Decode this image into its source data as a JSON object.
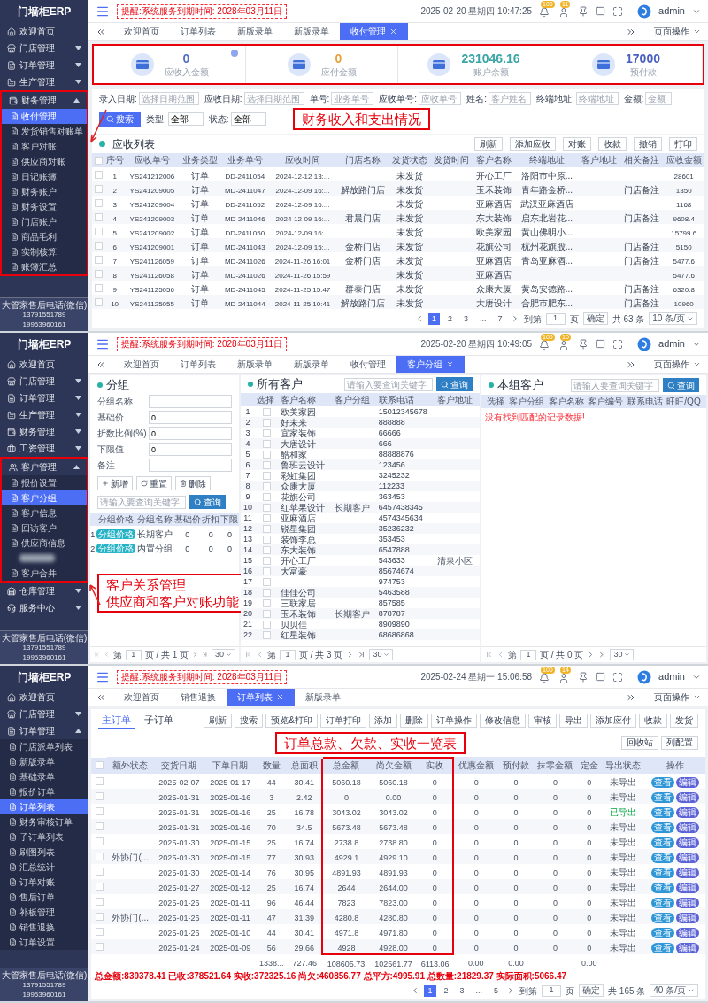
{
  "panels": [
    {
      "kind": "receivables",
      "sidebar": {
        "logo": "门墙柜ERP",
        "items": [
          {
            "label": "欢迎首页"
          },
          {
            "label": "门店管理",
            "expanded": false
          },
          {
            "label": "订单管理",
            "expanded": false
          },
          {
            "label": "生产管理",
            "expanded": false
          },
          {
            "label": "财务管理",
            "expanded": true,
            "highlighted": true,
            "children": [
              {
                "label": "收付管理",
                "selected": true
              },
              {
                "label": "发货销售对账单",
                "selected": false
              },
              {
                "label": "客户对账",
                "selected": false
              },
              {
                "label": "供应商对账",
                "selected": false
              },
              {
                "label": "日记账簿",
                "selected": false
              },
              {
                "label": "财务账户",
                "selected": false
              },
              {
                "label": "财务设置",
                "selected": false
              },
              {
                "label": "门店账户",
                "selected": false
              },
              {
                "label": "商品毛利",
                "selected": false
              },
              {
                "label": "实制核算",
                "selected": false
              },
              {
                "label": "账簿汇总",
                "selected": false
              }
            ]
          }
        ],
        "contact": [
          "大管家售后电话(微信)",
          "13791551789",
          "19953960161"
        ]
      },
      "topbar": {
        "notice": "提醒:系统服务到期时间: 2028年03月11日",
        "datetime": "2025-02-20 星期四 10:47:25",
        "badges": [
          "100",
          "11"
        ],
        "user": "admin"
      },
      "tabs": [
        {
          "label": "欢迎首页",
          "selected": false
        },
        {
          "label": "订单列表",
          "selected": false
        },
        {
          "label": "新版录单",
          "selected": false
        },
        {
          "label": "新版录单",
          "selected": false
        },
        {
          "label": "收付管理",
          "selected": true
        }
      ],
      "page_menu": "页面操作",
      "stats": [
        {
          "value": "0",
          "label": "应收入金额",
          "color": "#5470c6"
        },
        {
          "value": "0",
          "label": "应付金额",
          "color": "#e6a23c"
        },
        {
          "value": "231046.16",
          "label": "账户余额",
          "color": "#3aa6a6"
        },
        {
          "value": "17000",
          "label": "预付款",
          "color": "#4a5fc1"
        }
      ],
      "filters": [
        {
          "label": "录入日期:",
          "placeholder": "选择日期范围"
        },
        {
          "label": "应收日期:",
          "placeholder": "选择日期范围"
        },
        {
          "label": "单号:",
          "placeholder": "业务单号"
        },
        {
          "label": "应收单号:",
          "placeholder": "应收单号"
        },
        {
          "label": "姓名:",
          "placeholder": "客户姓名"
        },
        {
          "label": "终端地址:",
          "placeholder": "终端地址"
        },
        {
          "label": "金额:",
          "placeholder": "金额"
        }
      ],
      "search_button": "搜索",
      "filters_2": [
        {
          "label": "类型:",
          "value": "全部"
        },
        {
          "label": "状态:",
          "value": "全部"
        }
      ],
      "callout": "财务收入和支出情况",
      "list_title": "应收列表",
      "toolbar": [
        "刷新",
        "添加应收",
        "对账",
        "收款",
        "撤销",
        "打印"
      ],
      "table": {
        "select_all_checked": false,
        "columns": [
          "序号",
          "应收单号",
          "业务类型",
          "业务单号",
          "应收时间",
          "门店名称",
          "发货状态",
          "发货时间",
          "客户名称",
          "终端地址",
          "客户地址",
          "相关备注",
          "应收金额"
        ],
        "rows": [
          {
            "checked": false,
            "cells": [
              "1",
              "YS241212006",
              "订单",
              "DD-2411054",
              "2024-12-12 13:...",
              null,
              "未发货",
              null,
              "开心工厂",
              "洛阳市中原...",
              null,
              null,
              "28601"
            ]
          },
          {
            "checked": false,
            "cells": [
              "2",
              "YS241209005",
              "订单",
              "MD-2411047",
              "2024-12-09 16:...",
              "解放路门店",
              "未发货",
              null,
              "玉禾装饰",
              "青年路金桥...",
              null,
              "门店备注",
              "1350"
            ]
          },
          {
            "checked": false,
            "cells": [
              "3",
              "YS241209004",
              "订单",
              "DD-2411052",
              "2024-12-09 16:...",
              null,
              "未发货",
              null,
              "亚麻酒店",
              "武汉亚麻酒店",
              null,
              null,
              "1168"
            ]
          },
          {
            "checked": false,
            "cells": [
              "4",
              "YS241209003",
              "订单",
              "MD-2411046",
              "2024-12-09 16:...",
              "君晨门店",
              "未发货",
              null,
              "东大装饰",
              "启东北岩花...",
              null,
              "门店备注",
              "9608.4"
            ]
          },
          {
            "checked": false,
            "cells": [
              "5",
              "YS241209002",
              "订单",
              "DD-2411050",
              "2024-12-09 16:...",
              null,
              "未发货",
              null,
              "欧美家园",
              "黄山佛明小...",
              null,
              null,
              "15799.6"
            ]
          },
          {
            "checked": false,
            "cells": [
              "6",
              "YS241209001",
              "订单",
              "MD-2411043",
              "2024-12-09 15:...",
              "金桥门店",
              "未发货",
              null,
              "花旗公司",
              "杭州花旗股...",
              null,
              "门店备注",
              "5150"
            ]
          },
          {
            "checked": false,
            "cells": [
              "7",
              "YS241126059",
              "订单",
              "MD-2411026",
              "2024-11-26 16:01",
              "金桥门店",
              "未发货",
              null,
              "亚麻酒店",
              "青岛亚麻酒...",
              null,
              "门店备注",
              "5477.6"
            ]
          },
          {
            "checked": false,
            "cells": [
              "8",
              "YS241126058",
              "订单",
              "MD-2411026",
              "2024-11-26 15:59",
              null,
              "未发货",
              null,
              "亚麻酒店",
              null,
              null,
              null,
              "5477.6"
            ]
          },
          {
            "checked": false,
            "cells": [
              "9",
              "YS241125056",
              "订单",
              "MD-2411045",
              "2024-11-25 15:47",
              "群泰门店",
              "未发货",
              null,
              "众康大厦",
              "黄岛安德路...",
              null,
              "门店备注",
              "6320.8"
            ]
          },
          {
            "checked": false,
            "cells": [
              "10",
              "YS241125055",
              "订单",
              "MD-2411044",
              "2024-11-25 10:41",
              "解放路门店",
              "未发货",
              null,
              "大唐设计",
              "合肥市肥东...",
              null,
              "门店备注",
              "10960"
            ]
          }
        ]
      },
      "pagination": {
        "pages": [
          {
            "label": "1",
            "selected": true
          },
          {
            "label": "2",
            "selected": false
          },
          {
            "label": "3",
            "selected": false
          },
          {
            "label": "...",
            "selected": false
          },
          {
            "label": "7",
            "selected": false
          }
        ],
        "goto": "到第",
        "page": "1",
        "page_unit": "页",
        "confirm": "确定",
        "total": "共 63 条",
        "per_page": "10 条/页"
      }
    },
    {
      "kind": "customer_groups",
      "sidebar": {
        "logo": "门墙柜ERP",
        "items": [
          {
            "label": "欢迎首页"
          },
          {
            "label": "门店管理",
            "expanded": false
          },
          {
            "label": "订单管理",
            "expanded": false
          },
          {
            "label": "生产管理",
            "expanded": false
          },
          {
            "label": "财务管理",
            "expanded": false
          },
          {
            "label": "工资管理",
            "expanded": false
          },
          {
            "label": "客户管理",
            "expanded": true,
            "highlighted": true,
            "children": [
              {
                "label": "报价设置",
                "selected": false
              },
              {
                "label": "客户分组",
                "selected": true
              },
              {
                "label": "客户信息",
                "selected": false
              },
              {
                "label": "回访客户",
                "selected": false
              },
              {
                "label": "供应商信息",
                "selected": false
              },
              {
                "kind": "blurred",
                "selected": false
              },
              {
                "label": "客户合并",
                "selected": false
              }
            ]
          },
          {
            "label": "仓库管理",
            "expanded": false
          },
          {
            "label": "服务中心",
            "expanded": false
          }
        ],
        "contact": [
          "大管家售后电话(微信)",
          "13791551789",
          "19953960161"
        ]
      },
      "topbar": {
        "notice": "提醒:系统服务到期时间: 2028年03月11日",
        "datetime": "2025-02-20 星期四 10:49:05",
        "badges": [
          "100",
          "10"
        ],
        "user": "admin"
      },
      "tabs": [
        {
          "label": "欢迎首页",
          "selected": false
        },
        {
          "label": "订单列表",
          "selected": false
        },
        {
          "label": "新版录单",
          "selected": false
        },
        {
          "label": "新版录单",
          "selected": false
        },
        {
          "label": "收付管理",
          "selected": false
        },
        {
          "label": "客户分组",
          "selected": true
        }
      ],
      "page_menu": "页面操作",
      "group_panel": {
        "title": "分组",
        "fields": [
          {
            "label": "分组名称"
          },
          {
            "label": "基础价",
            "value": "0"
          },
          {
            "label": "折数比例(%)",
            "value": "0"
          },
          {
            "label": "下限值",
            "value": "0"
          },
          {
            "label": "备注"
          }
        ],
        "buttons": [
          "新增",
          "重置",
          "删除"
        ],
        "search": {
          "placeholder": "请输入要查询关键字",
          "button": "查询"
        },
        "columns": [
          "分组价格",
          "分组名称",
          "基础价",
          "折扣",
          "下限"
        ],
        "rows": [
          {
            "index": "1",
            "price_tag": "分组价格",
            "group_name": "长期客户",
            "base_price": "0",
            "discount": "0",
            "lower_limit": "0"
          },
          {
            "index": "2",
            "price_tag": "分组价格",
            "group_name": "内置分组",
            "base_price": "0",
            "discount": "0",
            "lower_limit": "0"
          }
        ],
        "pagination": {
          "page_label": "第",
          "page": "1",
          "of": "页 / 共 1 页",
          "per_page": "30"
        }
      },
      "callout": [
        "客户关系管理",
        "供应商和客户对账功能"
      ],
      "all_customers": {
        "title": "所有客户",
        "search": {
          "placeholder": "请输入要查询关键字",
          "button": "查询"
        },
        "columns": [
          "选择",
          "客户名称",
          "客户分组",
          "联系电话",
          "客户地址"
        ],
        "rows": [
          {
            "index": "1",
            "checked": false,
            "name": "欧美家园",
            "phone": "15012345678"
          },
          {
            "index": "2",
            "checked": false,
            "name": "好未来",
            "phone": "888888"
          },
          {
            "index": "3",
            "checked": false,
            "name": "宜家装饰",
            "phone": "66666"
          },
          {
            "index": "4",
            "checked": false,
            "name": "大唐设计",
            "phone": "666"
          },
          {
            "index": "5",
            "checked": false,
            "name": "酷和家",
            "phone": "88888876"
          },
          {
            "index": "6",
            "checked": false,
            "name": "鲁班云设计",
            "phone": "123456"
          },
          {
            "index": "7",
            "checked": false,
            "name": "彩虹集团",
            "phone": "3245232"
          },
          {
            "index": "8",
            "checked": false,
            "name": "众康大厦",
            "phone": "112233"
          },
          {
            "index": "9",
            "checked": false,
            "name": "花旗公司",
            "phone": "363453"
          },
          {
            "index": "10",
            "checked": false,
            "name": "红苹果设计",
            "group": "长期客户",
            "phone": "6457438345"
          },
          {
            "index": "11",
            "checked": false,
            "name": "亚麻酒店",
            "phone": "4574345634"
          },
          {
            "index": "12",
            "checked": false,
            "name": "锐星集团",
            "phone": "35236232"
          },
          {
            "index": "13",
            "checked": false,
            "name": "装饰李总",
            "phone": "353453"
          },
          {
            "index": "14",
            "checked": false,
            "name": "东大装饰",
            "phone": "6547888"
          },
          {
            "index": "15",
            "checked": false,
            "name": "开心工厂",
            "phone": "543633",
            "address": "清泉小区"
          },
          {
            "index": "16",
            "checked": false,
            "name": "大富豪",
            "phone": "85674674"
          },
          {
            "index": "17",
            "checked": false,
            "phone": "974753"
          },
          {
            "index": "18",
            "checked": false,
            "name": "佳佳公司",
            "phone": "5463588"
          },
          {
            "index": "19",
            "checked": false,
            "name": "三联家居",
            "phone": "857585"
          },
          {
            "index": "20",
            "checked": false,
            "name": "玉禾装饰",
            "group": "长期客户",
            "phone": "878787"
          },
          {
            "index": "21",
            "checked": false,
            "name": "贝贝佳",
            "phone": "8909890"
          },
          {
            "index": "22",
            "checked": false,
            "name": "红星装饰",
            "phone": "68686868"
          }
        ],
        "pagination": {
          "page_label": "第",
          "page": "1",
          "of": "页 / 共 3 页",
          "per_page": "30"
        }
      },
      "group_customers": {
        "title": "本组客户",
        "search": {
          "placeholder": "请输入要查询关键字",
          "button": "查询"
        },
        "columns": [
          "选择",
          "客户分组",
          "客户名称",
          "客户编号",
          "联系电话",
          "旺旺/QQ"
        ],
        "empty": "没有找到匹配的记录数据!",
        "pagination": {
          "page_label": "第",
          "page": "1",
          "of": "页 / 共 0 页",
          "per_page": "30"
        }
      }
    },
    {
      "kind": "orders",
      "sidebar": {
        "logo": "门墙柜ERP",
        "items": [
          {
            "label": "欢迎首页"
          },
          {
            "label": "门店管理",
            "expanded": false
          },
          {
            "label": "订单管理",
            "expanded": true,
            "children": [
              {
                "label": "门店派单列表",
                "selected": false
              },
              {
                "label": "新版录单",
                "selected": false
              },
              {
                "label": "基础录单",
                "selected": false
              },
              {
                "label": "报价订单",
                "selected": false
              },
              {
                "label": "订单列表",
                "selected": true
              },
              {
                "label": "财务审核订单",
                "selected": false
              },
              {
                "label": "子订单列表",
                "selected": false
              },
              {
                "label": "刷图列表",
                "selected": false
              },
              {
                "label": "汇总统计",
                "selected": false
              },
              {
                "label": "订单对账",
                "selected": false
              },
              {
                "label": "售后订单",
                "selected": false
              },
              {
                "label": "补板管理",
                "selected": false
              },
              {
                "label": "销售退换",
                "selected": false
              },
              {
                "label": "订单设置",
                "selected": false
              }
            ]
          }
        ],
        "contact": [
          "大管家售后电话(微信)",
          "13791551789",
          "19953960161"
        ]
      },
      "topbar": {
        "notice": "提醒:系统服务到期时间: 2028年03月11日",
        "datetime": "2025-02-24 星期一 15:06:58",
        "badges": [
          "100",
          "14"
        ],
        "user": "admin"
      },
      "tabs": [
        {
          "label": "欢迎首页",
          "selected": false
        },
        {
          "label": "销售退换",
          "selected": false
        },
        {
          "label": "订单列表",
          "selected": true
        },
        {
          "label": "新版录单",
          "selected": false
        }
      ],
      "page_menu": "页面操作",
      "subtabs": [
        {
          "label": "主订单",
          "selected": true
        },
        {
          "label": "子订单",
          "selected": false
        }
      ],
      "toolbar": [
        "刷新",
        "搜索",
        "预览&打印",
        "订单打印",
        "添加",
        "删除",
        "订单操作",
        "修改信息",
        "审核",
        "导出",
        "添加应付",
        "收款",
        "发货"
      ],
      "toolbar_2": [
        "回收站",
        "列配置"
      ],
      "callout": "订单总款、欠款、实收一览表",
      "table": {
        "select_all_checked": false,
        "columns": [
          {
            "label": "额外状态",
            "highlighted": false
          },
          {
            "label": "交货日期",
            "highlighted": false
          },
          {
            "label": "下单日期",
            "highlighted": false
          },
          {
            "label": "数量",
            "highlighted": false,
            "total": "1338..."
          },
          {
            "label": "总面积",
            "highlighted": false,
            "total": "727.46"
          },
          {
            "label": "总金额",
            "highlighted": true,
            "total": "108605.73"
          },
          {
            "label": "尚欠金额",
            "highlighted": true,
            "total": "102561.77"
          },
          {
            "label": "实收",
            "highlighted": true,
            "total": "6113.06"
          },
          {
            "label": "优惠金额",
            "highlighted": false,
            "total": "0.00"
          },
          {
            "label": "预付款",
            "highlighted": false,
            "total": "0.00"
          },
          {
            "label": "抹零金额",
            "highlighted": false
          },
          {
            "label": "定金",
            "highlighted": false,
            "total": "0.00"
          },
          {
            "label": "导出状态",
            "highlighted": false
          },
          {
            "label": "操作",
            "highlighted": false
          }
        ],
        "rows": [
          {
            "checked": false,
            "delivery_date": "2025-02-07",
            "order_date": "2025-01-17",
            "quantity": "44",
            "area": "30.41",
            "total": "5060.18",
            "owed": "5060.18",
            "received": "0",
            "discount": "0",
            "prepaid": "0",
            "rounding": "0",
            "deposit": "0",
            "export_state": "未导出",
            "exported": false,
            "actions": [
              "查看",
              "编辑"
            ]
          },
          {
            "checked": false,
            "delivery_date": "2025-01-31",
            "order_date": "2025-01-16",
            "quantity": "3",
            "area": "2.42",
            "total": "0",
            "owed": "0.00",
            "received": "0",
            "discount": "0",
            "prepaid": "0",
            "rounding": "0",
            "deposit": "0",
            "export_state": "未导出",
            "exported": false,
            "actions": [
              "查看",
              "编辑"
            ]
          },
          {
            "checked": false,
            "delivery_date": "2025-01-31",
            "order_date": "2025-01-16",
            "quantity": "25",
            "area": "16.78",
            "total": "3043.02",
            "owed": "3043.02",
            "received": "0",
            "discount": "0",
            "prepaid": "0",
            "rounding": "0",
            "deposit": "0",
            "export_state": "已导出",
            "exported": true,
            "actions": [
              "查看",
              "编辑"
            ]
          },
          {
            "checked": false,
            "delivery_date": "2025-01-31",
            "order_date": "2025-01-16",
            "quantity": "70",
            "area": "34.5",
            "total": "5673.48",
            "owed": "5673.48",
            "received": "0",
            "discount": "0",
            "prepaid": "0",
            "rounding": "0",
            "deposit": "0",
            "export_state": "未导出",
            "exported": false,
            "actions": [
              "查看",
              "编辑"
            ]
          },
          {
            "checked": false,
            "delivery_date": "2025-01-30",
            "order_date": "2025-01-15",
            "quantity": "25",
            "area": "16.74",
            "total": "2738.8",
            "owed": "2738.80",
            "received": "0",
            "discount": "0",
            "prepaid": "0",
            "rounding": "0",
            "deposit": "0",
            "export_state": "未导出",
            "exported": false,
            "actions": [
              "查看",
              "编辑"
            ]
          },
          {
            "checked": false,
            "extra_status": "外协门(...",
            "delivery_date": "2025-01-30",
            "order_date": "2025-01-15",
            "quantity": "77",
            "area": "30.93",
            "total": "4929.1",
            "owed": "4929.10",
            "received": "0",
            "discount": "0",
            "prepaid": "0",
            "rounding": "0",
            "deposit": "0",
            "export_state": "未导出",
            "exported": false,
            "actions": [
              "查看",
              "编辑"
            ]
          },
          {
            "checked": false,
            "delivery_date": "2025-01-30",
            "order_date": "2025-01-14",
            "quantity": "76",
            "area": "30.95",
            "total": "4891.93",
            "owed": "4891.93",
            "received": "0",
            "discount": "0",
            "prepaid": "0",
            "rounding": "0",
            "deposit": "0",
            "export_state": "未导出",
            "exported": false,
            "actions": [
              "查看",
              "编辑"
            ]
          },
          {
            "checked": false,
            "delivery_date": "2025-01-27",
            "order_date": "2025-01-12",
            "quantity": "25",
            "area": "16.74",
            "total": "2644",
            "owed": "2644.00",
            "received": "0",
            "discount": "0",
            "prepaid": "0",
            "rounding": "0",
            "deposit": "0",
            "export_state": "未导出",
            "exported": false,
            "actions": [
              "查看",
              "编辑"
            ]
          },
          {
            "checked": false,
            "delivery_date": "2025-01-26",
            "order_date": "2025-01-11",
            "quantity": "96",
            "area": "46.44",
            "total": "7823",
            "owed": "7823.00",
            "received": "0",
            "discount": "0",
            "prepaid": "0",
            "rounding": "0",
            "deposit": "0",
            "export_state": "未导出",
            "exported": false,
            "actions": [
              "查看",
              "编辑"
            ]
          },
          {
            "checked": false,
            "extra_status": "外协门(...",
            "delivery_date": "2025-01-26",
            "order_date": "2025-01-11",
            "quantity": "47",
            "area": "31.39",
            "total": "4280.8",
            "owed": "4280.80",
            "received": "0",
            "discount": "0",
            "prepaid": "0",
            "rounding": "0",
            "deposit": "0",
            "export_state": "未导出",
            "exported": false,
            "actions": [
              "查看",
              "编辑"
            ]
          },
          {
            "checked": false,
            "delivery_date": "2025-01-26",
            "order_date": "2025-01-10",
            "quantity": "44",
            "area": "30.41",
            "total": "4971.8",
            "owed": "4971.80",
            "received": "0",
            "discount": "0",
            "prepaid": "0",
            "rounding": "0",
            "deposit": "0",
            "export_state": "未导出",
            "exported": false,
            "actions": [
              "查看",
              "编辑"
            ]
          },
          {
            "checked": false,
            "delivery_date": "2025-01-24",
            "order_date": "2025-01-09",
            "quantity": "56",
            "area": "29.66",
            "total": "4928",
            "owed": "4928.00",
            "received": "0",
            "discount": "0",
            "prepaid": "0",
            "rounding": "0",
            "deposit": "0",
            "export_state": "未导出",
            "exported": false,
            "actions": [
              "查看",
              "编辑"
            ]
          }
        ]
      },
      "summary": "总金额:839378.41 已收:378521.64 实收:372325.16 尚欠:460856.77 总平方:4995.91 总数量:21829.37 实际面积:5066.47",
      "pagination": {
        "pages": [
          {
            "label": "1",
            "selected": true
          },
          {
            "label": "2",
            "selected": false
          },
          {
            "label": "3",
            "selected": false
          },
          {
            "label": "...",
            "selected": false
          },
          {
            "label": "5",
            "selected": false
          }
        ],
        "goto": "到第",
        "page": "1",
        "page_unit": "页",
        "confirm": "确定",
        "total": "共 165 条",
        "per_page": "40 条/页"
      }
    }
  ]
}
